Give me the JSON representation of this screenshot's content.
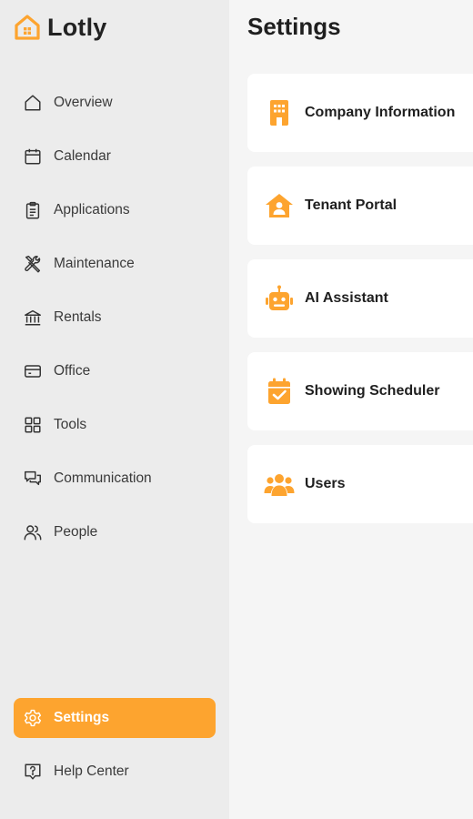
{
  "brand": {
    "name": "Lotly",
    "color": "#fda42f"
  },
  "sidebar": {
    "items": [
      {
        "label": "Overview",
        "icon": "home-icon"
      },
      {
        "label": "Calendar",
        "icon": "calendar-icon"
      },
      {
        "label": "Applications",
        "icon": "clipboard-icon"
      },
      {
        "label": "Maintenance",
        "icon": "tools-icon"
      },
      {
        "label": "Rentals",
        "icon": "bank-icon"
      },
      {
        "label": "Office",
        "icon": "card-icon"
      },
      {
        "label": "Tools",
        "icon": "grid-icon"
      },
      {
        "label": "Communication",
        "icon": "chat-icon"
      },
      {
        "label": "People",
        "icon": "people-icon"
      }
    ],
    "footer": [
      {
        "label": "Settings",
        "icon": "gear-icon",
        "active": true
      },
      {
        "label": "Help Center",
        "icon": "help-icon"
      }
    ]
  },
  "main": {
    "title": "Settings",
    "cards": [
      {
        "label": "Company Information",
        "icon": "building-icon"
      },
      {
        "label": "Tenant Portal",
        "icon": "house-user-icon"
      },
      {
        "label": "AI Assistant",
        "icon": "robot-icon"
      },
      {
        "label": "Showing Scheduler",
        "icon": "calendar-check-icon"
      },
      {
        "label": "Users",
        "icon": "users-icon"
      }
    ]
  },
  "colors": {
    "accent": "#fda42f",
    "sidebar_bg": "#ececec",
    "page_bg": "#f5f5f5",
    "card_bg": "#ffffff"
  }
}
